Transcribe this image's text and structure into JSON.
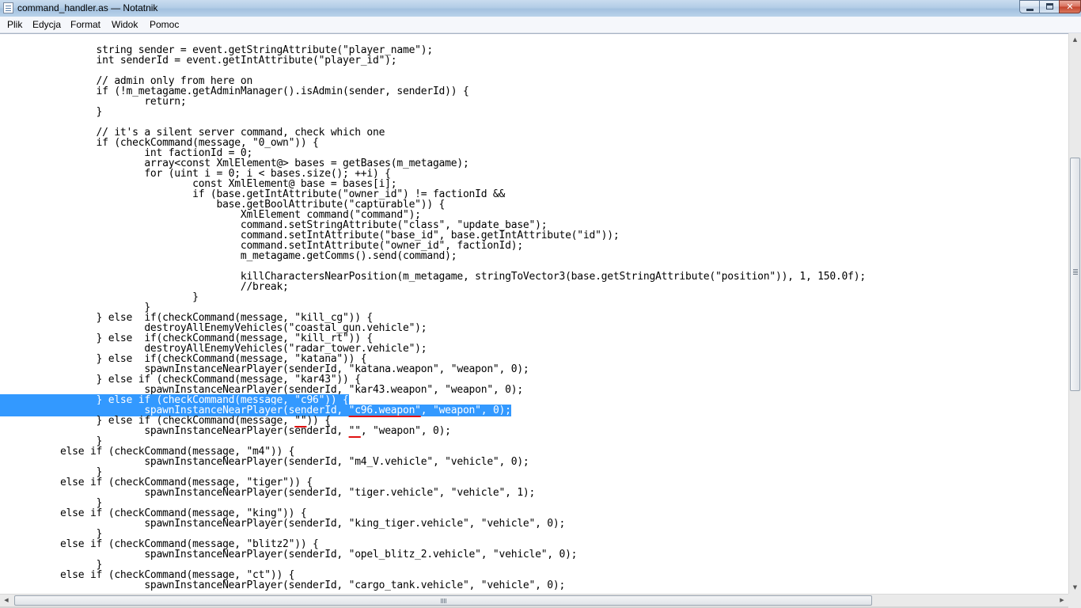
{
  "window": {
    "title": "command_handler.as — Notatnik",
    "icon": "notepad-icon",
    "buttons": {
      "minimize": "minimize-icon",
      "maximize": "maximize-icon",
      "close": "close-icon",
      "close_glyph": "✕"
    }
  },
  "menu": {
    "items": [
      "Plik",
      "Edycja",
      "Format",
      "Widok",
      "Pomoc"
    ]
  },
  "colors": {
    "selection": "#3399ff",
    "annotation_underline": "#e01010",
    "titlebar": "#b3cde6"
  },
  "editor": {
    "lines": [
      "                string sender = event.getStringAttribute(\"player_name\");",
      "                int senderId = event.getIntAttribute(\"player_id\");",
      "",
      "                // admin only from here on",
      "                if (!m_metagame.getAdminManager().isAdmin(sender, senderId)) {",
      "                        return;",
      "                }",
      "",
      "                // it's a silent server command, check which one",
      "                if (checkCommand(message, \"0_own\")) {",
      "                        int factionId = 0;",
      "                        array<const XmlElement@> bases = getBases(m_metagame);",
      "                        for (uint i = 0; i < bases.size(); ++i) {",
      "                                const XmlElement@ base = bases[i];",
      "                                if (base.getIntAttribute(\"owner_id\") != factionId &&",
      "                                    base.getBoolAttribute(\"capturable\")) {",
      "                                        XmlElement command(\"command\");",
      "                                        command.setStringAttribute(\"class\", \"update_base\");",
      "                                        command.setIntAttribute(\"base_id\", base.getIntAttribute(\"id\"));",
      "                                        command.setIntAttribute(\"owner_id\", factionId);",
      "                                        m_metagame.getComms().send(command);",
      "",
      "                                        killCharactersNearPosition(m_metagame, stringToVector3(base.getStringAttribute(\"position\")), 1, 150.0f);",
      "                                        //break;",
      "                                }",
      "                        }",
      "                } else  if(checkCommand(message, \"kill_cg\")) {",
      "                        destroyAllEnemyVehicles(\"coastal_gun.vehicle\");",
      "                } else  if(checkCommand(message, \"kill_rt\")) {",
      "                        destroyAllEnemyVehicles(\"radar_tower.vehicle\");",
      "                } else  if(checkCommand(message, \"katana\")) {",
      "                        spawnInstanceNearPlayer(senderId, \"katana.weapon\", \"weapon\", 0);",
      "                } else if (checkCommand(message, \"kar43\")) {",
      "                        spawnInstanceNearPlayer(senderId, \"kar43.weapon\", \"weapon\", 0);",
      "                } else if (checkCommand(message, \"c96\")) {",
      "                        spawnInstanceNearPlayer(senderId, \"c96.weapon\", \"weapon\", 0);",
      "                } else if (checkCommand(message, \"\")) {",
      "                        spawnInstanceNearPlayer(senderId, \"\", \"weapon\", 0);",
      "                }",
      "          else if (checkCommand(message, \"m4\")) {",
      "                        spawnInstanceNearPlayer(senderId, \"m4_V.vehicle\", \"vehicle\", 0);",
      "                }",
      "          else if (checkCommand(message, \"tiger\")) {",
      "                        spawnInstanceNearPlayer(senderId, \"tiger.vehicle\", \"vehicle\", 1);",
      "                }",
      "          else if (checkCommand(message, \"king\")) {",
      "                        spawnInstanceNearPlayer(senderId, \"king_tiger.vehicle\", \"vehicle\", 0);",
      "                }",
      "          else if (checkCommand(message, \"blitz2\")) {",
      "                        spawnInstanceNearPlayer(senderId, \"opel_blitz_2.vehicle\", \"vehicle\", 0);",
      "                }",
      "          else if (checkCommand(message, \"ct\")) {",
      "                        spawnInstanceNearPlayer(senderId, \"cargo_tank.vehicle\", \"vehicle\", 0);"
    ],
    "selection": {
      "first_line": 34,
      "last_line": 35,
      "underlined_text": [
        "\"c96\"",
        "\"c96.weapon\"",
        "\"\"",
        "\"\""
      ]
    }
  },
  "scrollbars": {
    "vertical_position": 0.32,
    "horizontal_position": 0.0
  }
}
